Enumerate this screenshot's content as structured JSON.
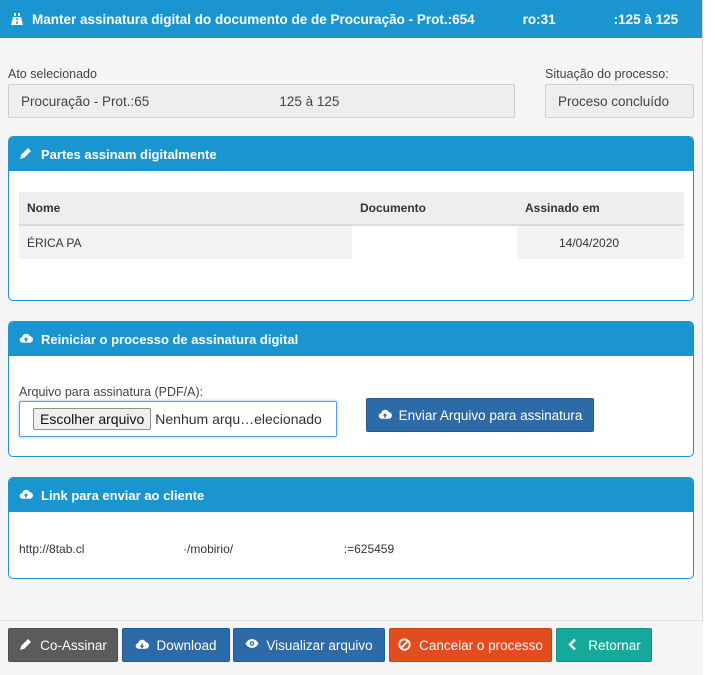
{
  "header": {
    "title_part1": "Manter assinatura digital do documento de de Procuração - Prot.:654",
    "title_part2": "ro:31",
    "title_part3": ":125 à 125"
  },
  "ato": {
    "label": "Ato selecionado",
    "value_left": "Procuração - Prot.:65",
    "value_right": "125 à 125"
  },
  "situacao": {
    "label": "Situação do processo:",
    "value": "Proceso concluído"
  },
  "partes_panel": {
    "title": "Partes assinam digitalmente",
    "columns": [
      "Nome",
      "Documento",
      "Assinado em"
    ],
    "rows": [
      {
        "nome": "ÉRICA PA",
        "documento": "",
        "assinado_em": "14/04/2020"
      }
    ]
  },
  "reiniciar_panel": {
    "title": "Reiniciar o processo de assinatura digital",
    "file_label": "Arquivo para assinatura (PDF/A):",
    "file_button": "Escolher arquivo",
    "file_status": "Nenhum arqu…elecionado",
    "send_button": "Enviar Arquivo para assinatura"
  },
  "link_panel": {
    "title": "Link para enviar ao cliente",
    "link_part1": "http://8tab.cl",
    "link_part2": "·/mobirio/",
    "link_part3": ":=625459"
  },
  "footer_buttons": {
    "co_assinar": "Co-Assinar",
    "download": "Download",
    "visualizar": "Visualizar arquivo",
    "cancelar": "Cancelar o processo",
    "retornar": "Retornar"
  },
  "colors": {
    "header_blue": "#1b95cf",
    "primary": "#2d6aa8",
    "gray": "#5b5b5b",
    "danger": "#e34c1c",
    "success": "#14a99a"
  }
}
